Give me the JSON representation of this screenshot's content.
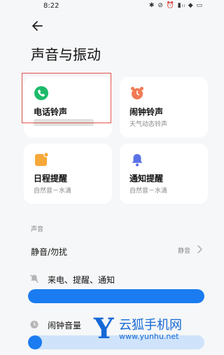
{
  "status_bar": {
    "time": "8:22",
    "icons": "✱ ⊘ ⏰ ▮ᵢₗ ◆ ▭"
  },
  "header": {
    "title": "声音与振动"
  },
  "cards": [
    {
      "label": "电话铃声",
      "sub": "",
      "icon": "phone-icon",
      "color": "#1dba6a"
    },
    {
      "label": "闹钟铃声",
      "sub": "天气动态铃声",
      "icon": "alarm-clock-icon",
      "color": "#f27a55"
    },
    {
      "label": "日程提醒",
      "sub": "自然音－水滴",
      "icon": "calendar-icon",
      "color": "#f6a83a"
    },
    {
      "label": "通知提醒",
      "sub": "自然音－水滴",
      "icon": "bell-icon",
      "color": "#5a72e6"
    }
  ],
  "section": {
    "header": "声音"
  },
  "silent": {
    "label": "静音/勿扰",
    "value": "静音"
  },
  "volumes": [
    {
      "label": "来电、提醒、通知",
      "icon": "muted-bell-icon",
      "level": 1.0
    },
    {
      "label": "闹钟音量",
      "icon": "clock-icon",
      "level": 0.08
    }
  ],
  "watermark": {
    "letter": "Y",
    "text": "云狐手机网",
    "url": "www.yunhu.net"
  },
  "colors": {
    "accent": "#1a7cf0",
    "highlight": "#e0554d",
    "watermark": "#1569d6"
  }
}
